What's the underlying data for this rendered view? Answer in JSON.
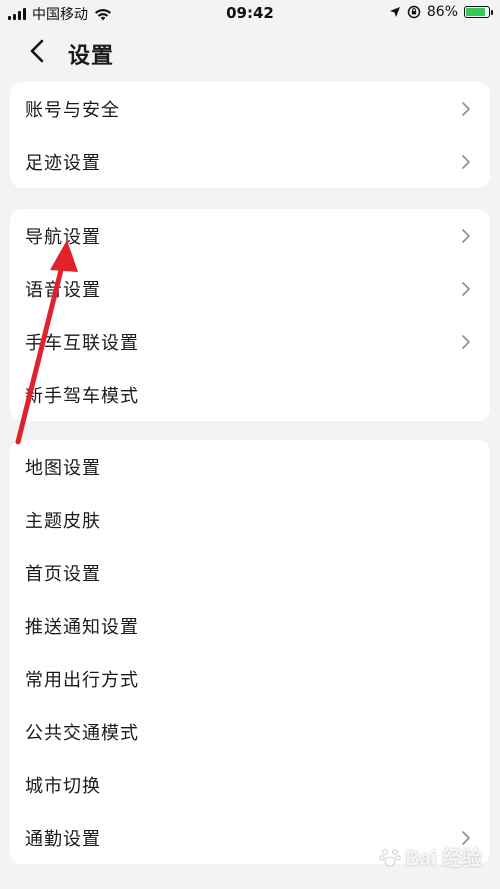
{
  "status_bar": {
    "carrier": "中国移动",
    "time": "09:42",
    "battery_percent": "86%",
    "battery_level": 0.86,
    "icons": [
      "signal-icon",
      "wifi-icon",
      "location-icon",
      "rotation-lock-icon",
      "battery-icon"
    ]
  },
  "header": {
    "title": "设置",
    "back_icon": "chevron-left-icon"
  },
  "groups": [
    {
      "items": [
        {
          "label": "账号与安全",
          "chevron": true
        },
        {
          "label": "足迹设置",
          "chevron": true
        }
      ]
    },
    {
      "items": [
        {
          "label": "导航设置",
          "chevron": true
        },
        {
          "label": "语音设置",
          "chevron": true
        },
        {
          "label": "手车互联设置",
          "chevron": true
        },
        {
          "label": "新手驾车模式",
          "chevron": false
        }
      ]
    },
    {
      "items": [
        {
          "label": "地图设置",
          "chevron": false
        },
        {
          "label": "主题皮肤",
          "chevron": false
        },
        {
          "label": "首页设置",
          "chevron": false
        },
        {
          "label": "推送通知设置",
          "chevron": false
        },
        {
          "label": "常用出行方式",
          "chevron": false
        },
        {
          "label": "公共交通模式",
          "chevron": false
        },
        {
          "label": "城市切换",
          "chevron": false
        },
        {
          "label": "通勤设置",
          "chevron": true
        }
      ]
    }
  ],
  "annotation": {
    "color": "#e0232b"
  },
  "watermark": {
    "text": "Bai 经验"
  },
  "colors": {
    "background": "#f2f3f5",
    "card": "#ffffff",
    "chevron": "#8e8e93",
    "battery": "#34c759"
  }
}
